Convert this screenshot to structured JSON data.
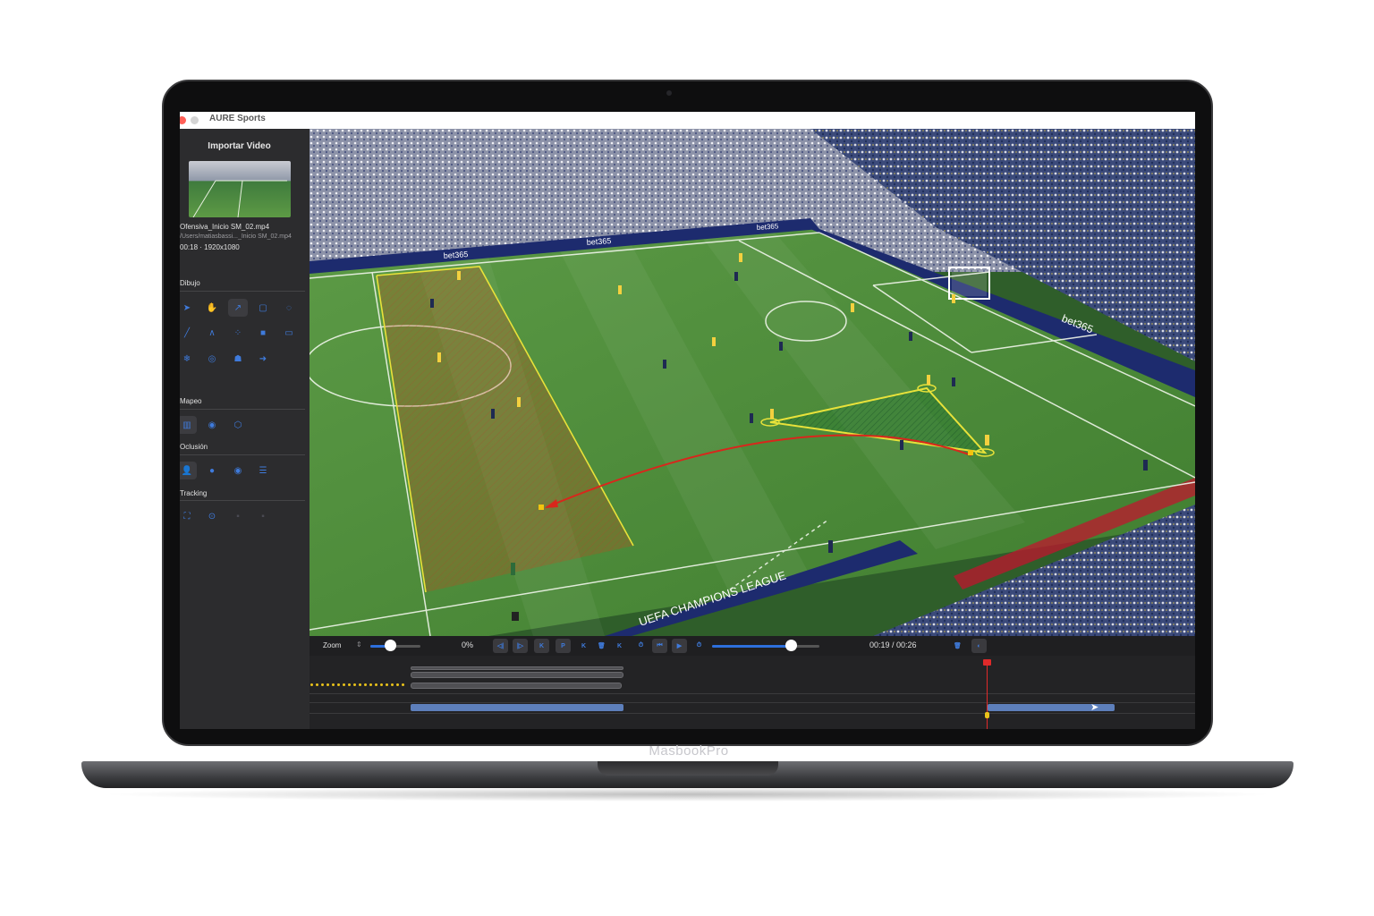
{
  "device": {
    "label": "MasbookPro"
  },
  "window": {
    "title": "AURE Sports",
    "close_color": "#ff5f57"
  },
  "sidebar": {
    "import_label": "Importar Video",
    "file": {
      "name": "Ofensiva_Inicio SM_02.mp4",
      "path": "/Users/matiasbassi..._Inicio SM_02.mp4",
      "meta": "00:18 · 1920x1080"
    },
    "sections": [
      {
        "title": "Dibujo",
        "tools": [
          "cursor-icon",
          "hand-icon",
          "arrow-icon",
          "rectangle-icon",
          "circle-icon",
          "line-icon",
          "angle-icon",
          "network-icon",
          "square-filled-icon",
          "comment-icon",
          "snowflake-icon",
          "target-icon",
          "spotlight-icon",
          "arrow-circle-icon"
        ]
      },
      {
        "title": "Mapeo",
        "tools": [
          "map-icon",
          "eye-icon",
          "cube-icon"
        ]
      },
      {
        "title": "Oclusión",
        "tools": [
          "person-icon",
          "circle-filled-icon",
          "eye-icon",
          "lines-icon"
        ]
      },
      {
        "title": "Tracking",
        "tools": [
          "bbox-icon",
          "play-circle-icon",
          "tracking-a-icon",
          "tracking-b-icon"
        ]
      }
    ]
  },
  "controls": {
    "zoom_label": "Zoom",
    "zoom_stepper": "⇕",
    "zoom_value": 0.4,
    "zoom_percent": "0%",
    "buttons": [
      "◁|",
      "|▷",
      "K",
      "P",
      "K",
      "🗑",
      "K"
    ],
    "transport": [
      "⏱",
      "⏮",
      "▶",
      "⏱"
    ],
    "progress": 0.73,
    "time": "00:19 / 00:26",
    "right_buttons": [
      "🗑",
      "◐"
    ]
  },
  "colors": {
    "accent": "#2d6fdc",
    "playhead": "#e02a2a",
    "keyframe": "#e8c21a"
  }
}
